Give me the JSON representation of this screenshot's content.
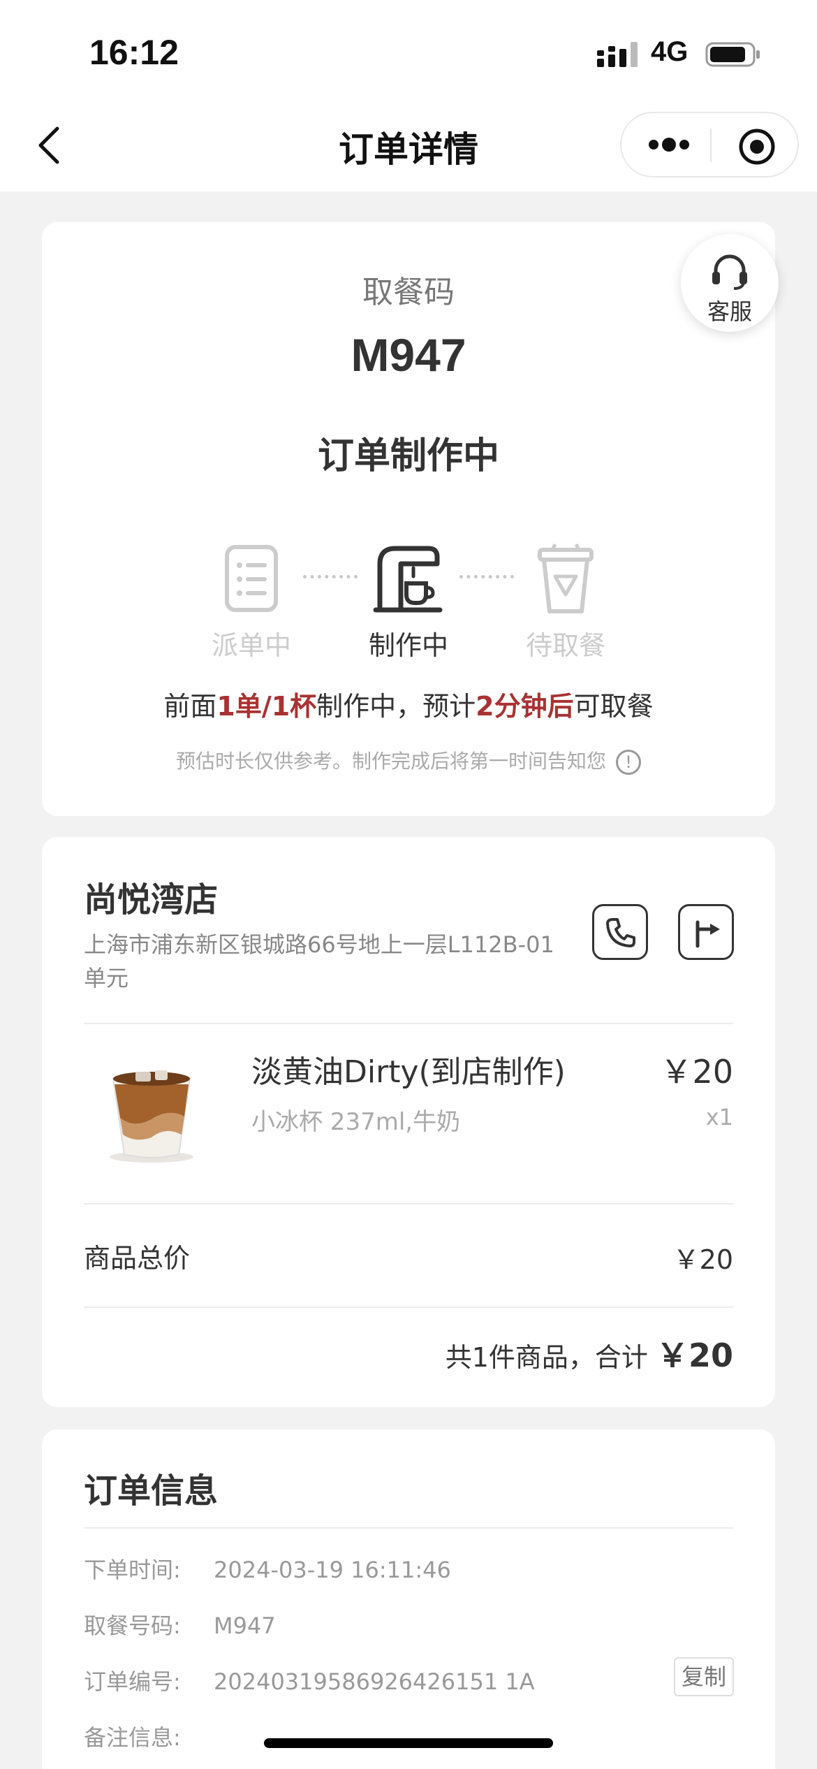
{
  "status_bar": {
    "time": "16:12",
    "network": "4G"
  },
  "nav": {
    "title": "订单详情"
  },
  "customer_service": {
    "label": "客服"
  },
  "order": {
    "pickup_label": "取餐码",
    "pickup_code": "M947",
    "status": "订单制作中",
    "steps": [
      {
        "label": "派单中"
      },
      {
        "label": "制作中"
      },
      {
        "label": "待取餐"
      }
    ],
    "queue": {
      "prefix": "前面",
      "count": "1单/1杯",
      "middle": "制作中，预计",
      "eta": "2分钟后",
      "suffix": "可取餐"
    },
    "hint": "预估时长仅供参考。制作完成后将第一时间告知您",
    "hint_icon": "!"
  },
  "store": {
    "name": "尚悦湾店",
    "address": "上海市浦东新区银城路66号地上一层L112B-01单元"
  },
  "product": {
    "name": "淡黄油Dirty(到店制作)",
    "spec": "小冰杯 237ml,牛奶",
    "price": "￥20",
    "qty": "x1"
  },
  "summary": {
    "subtotal_label": "商品总价",
    "subtotal_value": "￥20",
    "total_prefix": "共1件商品，合计",
    "total_amount": "￥20"
  },
  "info": {
    "title": "订单信息",
    "rows": [
      {
        "key": "下单时间:",
        "value": "2024-03-19 16:11:46"
      },
      {
        "key": "取餐号码:",
        "value": "M947"
      },
      {
        "key": "订单编号:",
        "value": "20240319586926426151 1A"
      },
      {
        "key": "备注信息:",
        "value": ""
      }
    ],
    "copy_label": "复制"
  },
  "colors": {
    "accent": "#a83232",
    "background": "#f2f2f2"
  }
}
